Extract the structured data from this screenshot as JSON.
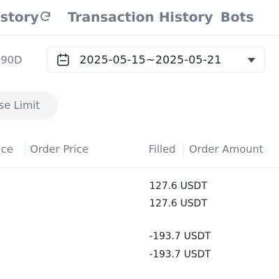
{
  "tabs": {
    "order_history": "istory",
    "transaction_history": "Transaction History",
    "bots": "Bots"
  },
  "icons": {
    "refresh": "refresh-icon",
    "calendar": "calendar-icon",
    "caret": "caret-down-icon"
  },
  "filters": {
    "range_label": "90D",
    "date_range": "2025-05-15~2025-05-21",
    "chip_label": "se Limit"
  },
  "table": {
    "columns": [
      "rice",
      "Order Price",
      "Filled",
      "Order Amount"
    ],
    "rows": [
      {
        "filled": "127.6 USDT",
        "filled_2": "127.6 USDT"
      },
      {
        "filled": "-193.7 USDT",
        "filled_2": "-193.7 USDT"
      }
    ]
  },
  "colors": {
    "text_primary": "#1e2329",
    "text_secondary": "#707a8a",
    "divider": "#eaecef",
    "chip_bg": "#f5f5f5"
  }
}
